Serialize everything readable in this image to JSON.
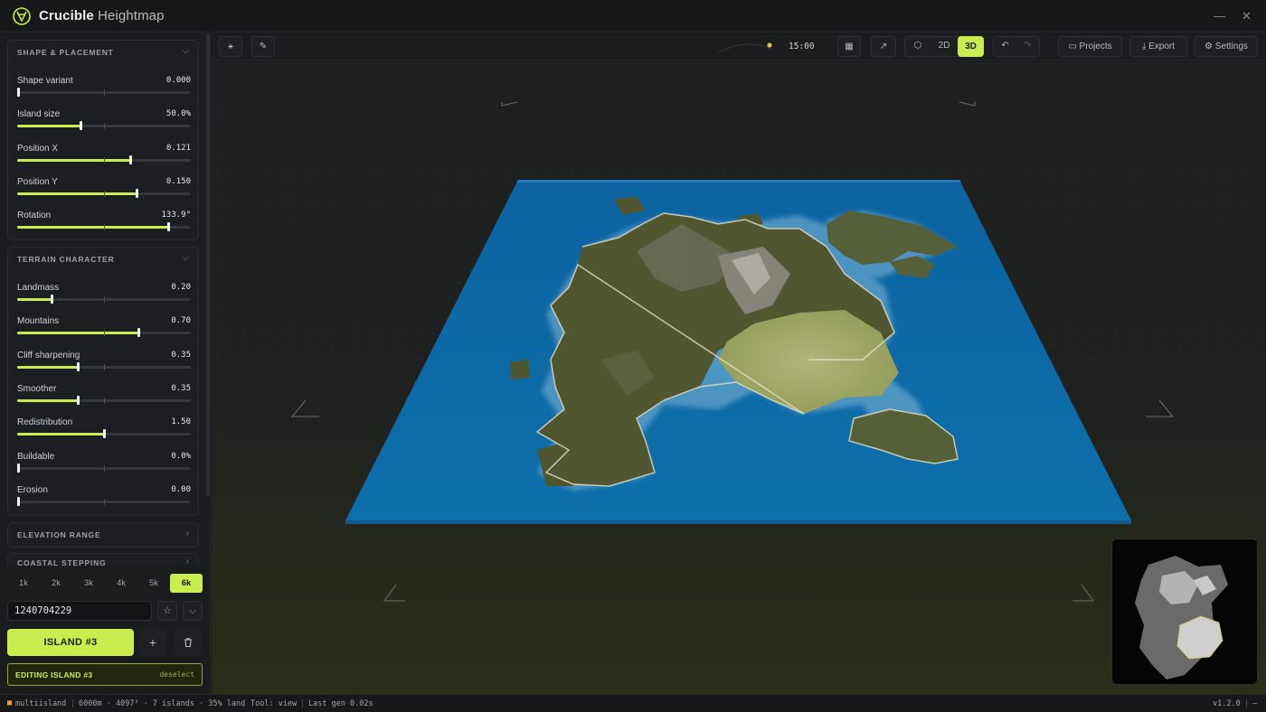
{
  "app": {
    "title_bold": "Crucible",
    "title_rest": "Heightmap",
    "minimize_icon": "minimize-icon",
    "close_icon": "close-icon"
  },
  "colors": {
    "accent": "#c9ec4f",
    "water": "#0c6aa6",
    "background": "#17181a"
  },
  "sections": {
    "shape": {
      "title": "SHAPE & PLACEMENT",
      "sliders": [
        {
          "label": "Shape variant",
          "value": "0.000",
          "level": 0.0
        },
        {
          "label": "Island size",
          "value": "50.0%",
          "level": 0.365
        },
        {
          "label": "Position X",
          "value": "0.121",
          "level": 0.65
        },
        {
          "label": "Position Y",
          "value": "0.150",
          "level": 0.685
        },
        {
          "label": "Rotation",
          "value": "133.9°",
          "level": 0.87
        }
      ]
    },
    "terrain": {
      "title": "TERRAIN CHARACTER",
      "sliders": [
        {
          "label": "Landmass",
          "value": "0.20",
          "level": 0.2
        },
        {
          "label": "Mountains",
          "value": "0.70",
          "level": 0.7
        },
        {
          "label": "Cliff sharpening",
          "value": "0.35",
          "level": 0.35
        },
        {
          "label": "Smoother",
          "value": "0.35",
          "level": 0.35
        },
        {
          "label": "Redistribution",
          "value": "1.50",
          "level": 0.5
        },
        {
          "label": "Buildable",
          "value": "0.0%",
          "level": 0.0
        },
        {
          "label": "Erosion",
          "value": "0.00",
          "level": 0.0
        }
      ]
    },
    "elevation": {
      "title": "ELEVATION RANGE"
    },
    "coastal": {
      "title": "COASTAL STEPPING"
    }
  },
  "resolutions": [
    "1k",
    "2k",
    "3k",
    "4k",
    "5k",
    "6k"
  ],
  "active_resolution": "6k",
  "seed": "1240704229",
  "island_button": "ISLAND #3",
  "editing": {
    "label": "EDITING ISLAND #3",
    "deselect": "deselect"
  },
  "toolbar": {
    "time": "15:00",
    "mode_2d": "2D",
    "mode_3d": "3D",
    "active_mode": "3D",
    "projects": "Projects",
    "export": "Export",
    "settings": "Settings"
  },
  "status": {
    "mode": "multiisland",
    "info": "6000m · 4097² · 7 islands · 35% land",
    "tool": "Tool: view",
    "last_gen": "Last gen 0.02s",
    "version": "v1.2.0",
    "dash": "—"
  }
}
